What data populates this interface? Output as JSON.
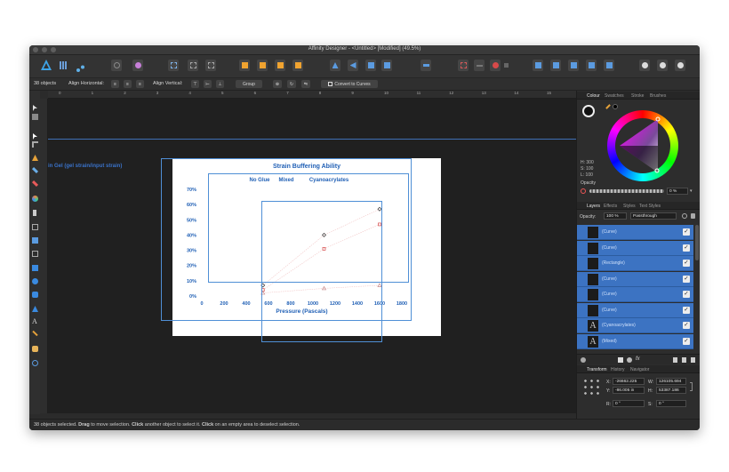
{
  "window": {
    "title": "Affinity Designer - <Untitled> [Modified] (49.5%)"
  },
  "context_bar": {
    "selection_count": "38 objects",
    "align_horizontal": "Align Horizontal:",
    "align_vertical": "Align Vertical:",
    "group_button": "Group",
    "convert_button": "Convert to Curves"
  },
  "ruler": {
    "marks": [
      "0",
      "1",
      "2",
      "3",
      "4",
      "5",
      "6",
      "7",
      "8",
      "9",
      "10",
      "11",
      "12",
      "13",
      "14",
      "15"
    ]
  },
  "canvas": {
    "outside_label": "in Gel (gel strain/input strain)",
    "chart_data": {
      "type": "scatter",
      "title": "Strain Buffering Ability",
      "xlabel": "Pressure (Pascals)",
      "ylabel": "",
      "x_ticks": [
        "0",
        "200",
        "400",
        "600",
        "800",
        "1000",
        "1200",
        "1400",
        "1600",
        "1800"
      ],
      "y_ticks": [
        "0%",
        "10%",
        "20%",
        "30%",
        "40%",
        "50%",
        "60%",
        "70%"
      ],
      "xlim": [
        0,
        1800
      ],
      "ylim": [
        0,
        70
      ],
      "legend": "top",
      "series": [
        {
          "name": "No Glue",
          "marker": "diamond",
          "x": [
            550,
            1100,
            1600
          ],
          "y": [
            7,
            40,
            57
          ]
        },
        {
          "name": "Mixed",
          "marker": "square",
          "x": [
            550,
            1100,
            1600
          ],
          "y": [
            4,
            31,
            47
          ]
        },
        {
          "name": "Cyanoacrylates",
          "marker": "triangle",
          "x": [
            550,
            1100,
            1600
          ],
          "y": [
            2,
            5,
            7
          ]
        }
      ]
    }
  },
  "status": {
    "prefix": "38 objects selected.",
    "drag": "Drag",
    "drag_text": "to move selection.",
    "click": "Click",
    "click_text": "another object to select it.",
    "click2": "Click",
    "click2_text": "on an empty area to deselect selection."
  },
  "colour_panel": {
    "tabs": [
      "Colour",
      "Swatches",
      "Stroke",
      "Brushes"
    ],
    "h": "H: 300",
    "s": "S: 100",
    "l": "L: 100",
    "opacity_label": "Opacity",
    "opacity_value": "0 %"
  },
  "layers_panel": {
    "tabs": [
      "Layers",
      "Effects",
      "Styles",
      "Text Styles"
    ],
    "opacity_label": "Opacity:",
    "opacity_value": "100 %",
    "blend_mode": "Passthrough",
    "items": [
      {
        "name": "(Curve)",
        "thumb": ""
      },
      {
        "name": "(Curve)",
        "thumb": ""
      },
      {
        "name": "(Rectangle)",
        "thumb": ""
      },
      {
        "name": "(Curve)",
        "thumb": ""
      },
      {
        "name": "(Curve)",
        "thumb": ""
      },
      {
        "name": "(Curve)",
        "thumb": ""
      },
      {
        "name": "(Cyanoacrylates)",
        "thumb": "A"
      },
      {
        "name": "(Mixed)",
        "thumb": "A"
      }
    ]
  },
  "transform_panel": {
    "tabs": [
      "Transform",
      "History",
      "Navigator"
    ],
    "x_label": "X:",
    "x_value": "-26662.225",
    "y_label": "Y:",
    "y_value": "-86.005 in",
    "w_label": "W:",
    "w_value": "126105.694",
    "h_label": "H:",
    "h_value": "53387.186",
    "r_label": "R:",
    "r_value": "0 °",
    "s_label": "S:",
    "s_value": "0 °"
  },
  "colors": {
    "accent": "#3c73c2",
    "chart_text": "#1f5fb5",
    "selection": "#4f8fd6"
  }
}
